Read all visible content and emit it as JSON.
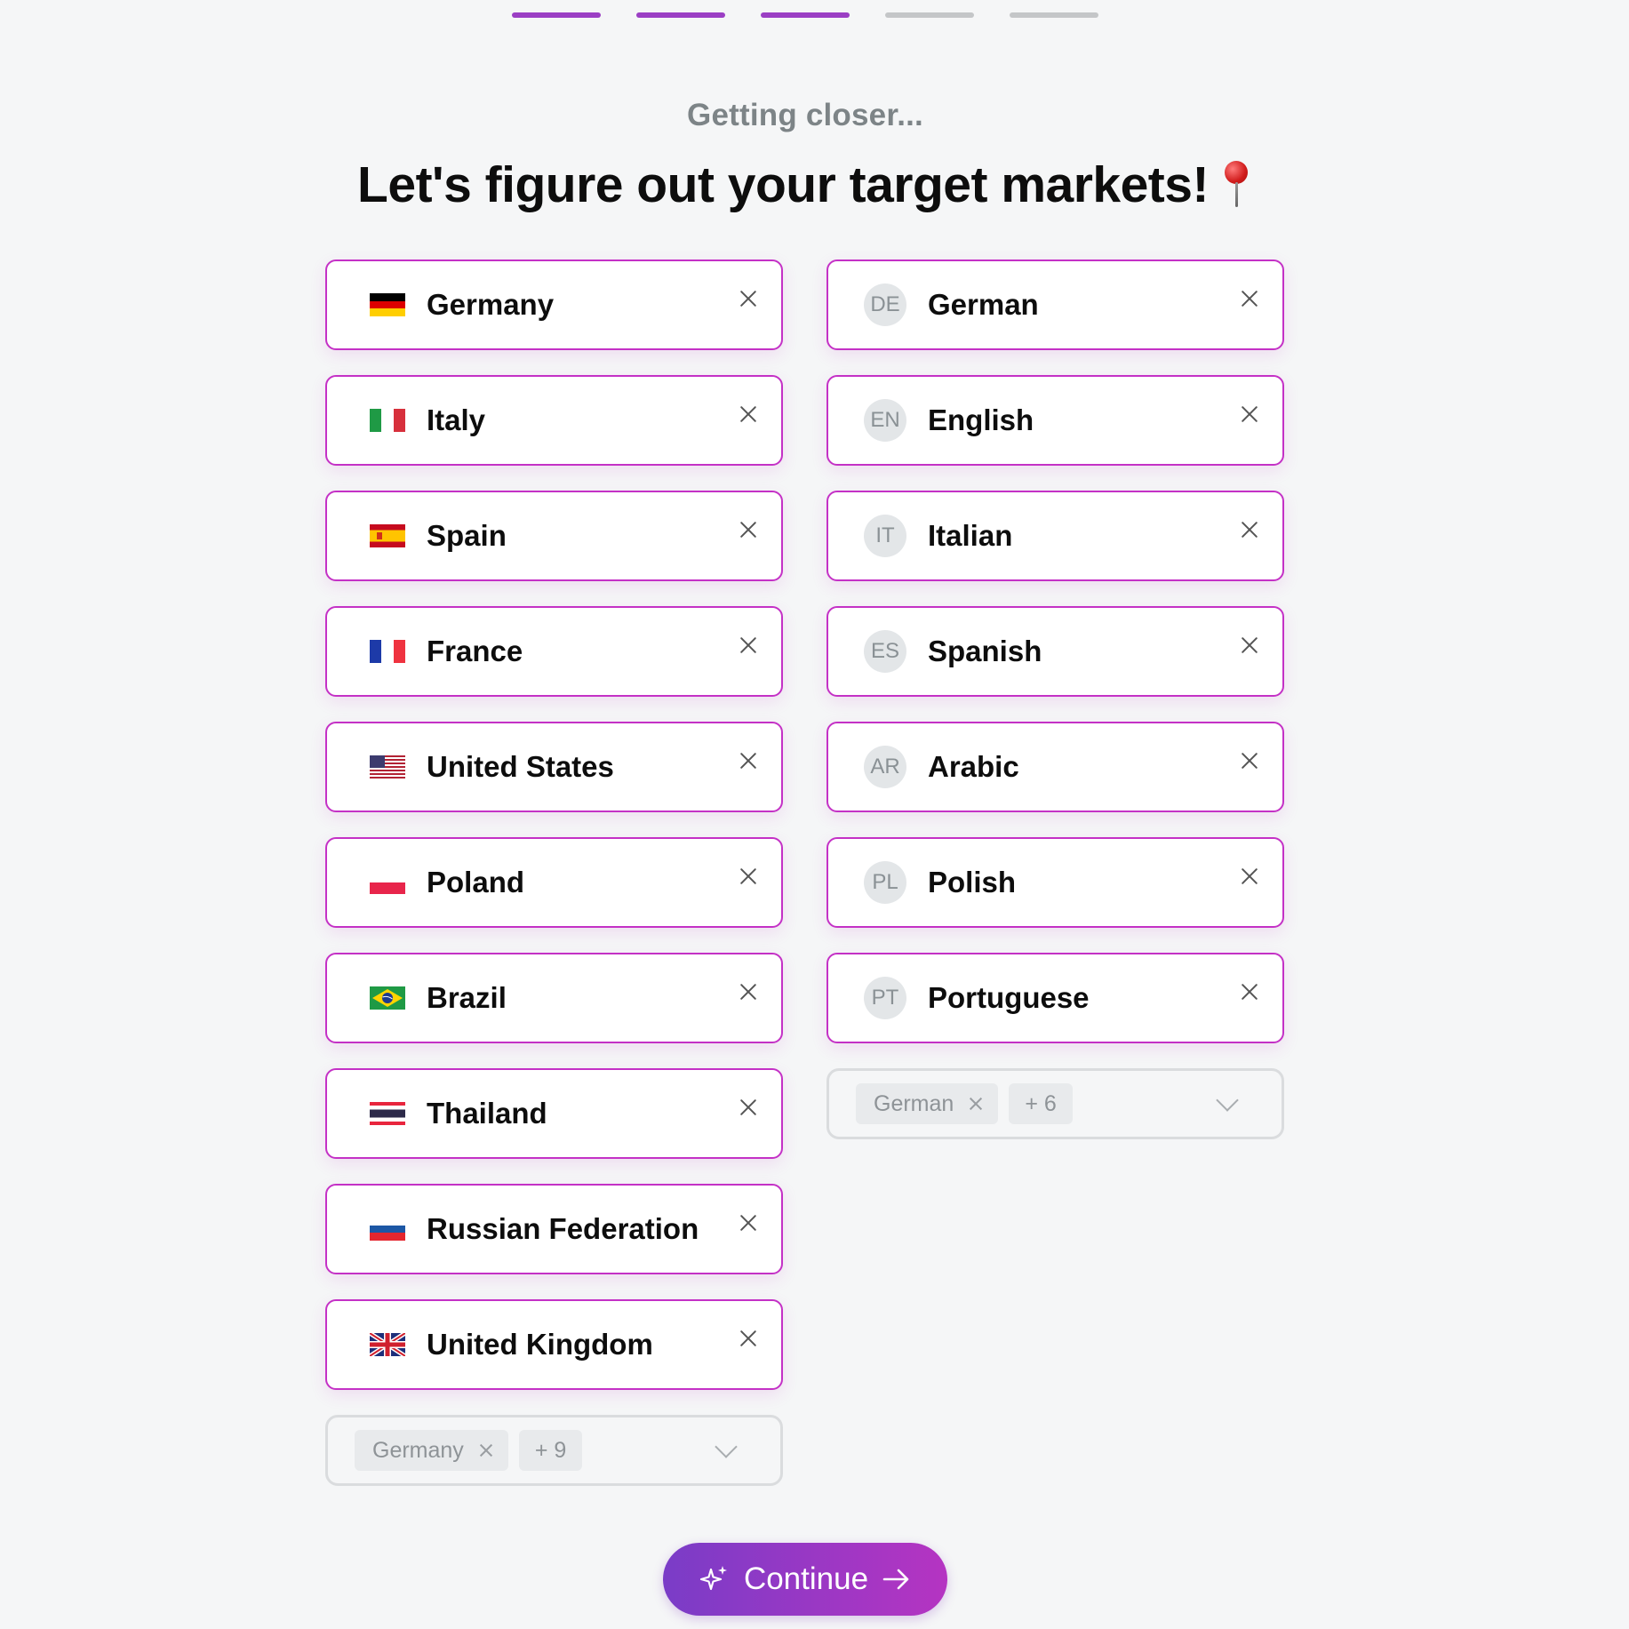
{
  "progress": {
    "steps_total": 5,
    "steps_done": 3
  },
  "header": {
    "subtitle": "Getting closer...",
    "title": "Let's figure out your target markets!",
    "title_emoji": "round-pushpin"
  },
  "countries": {
    "items": [
      {
        "label": "Germany",
        "flag": "de"
      },
      {
        "label": "Italy",
        "flag": "it"
      },
      {
        "label": "Spain",
        "flag": "es"
      },
      {
        "label": "France",
        "flag": "fr"
      },
      {
        "label": "United States",
        "flag": "us"
      },
      {
        "label": "Poland",
        "flag": "pl"
      },
      {
        "label": "Brazil",
        "flag": "br"
      },
      {
        "label": "Thailand",
        "flag": "th"
      },
      {
        "label": "Russian Federation",
        "flag": "ru"
      },
      {
        "label": "United Kingdom",
        "flag": "gb"
      }
    ],
    "select": {
      "tag": "Germany",
      "more": "+ 9"
    }
  },
  "languages": {
    "items": [
      {
        "code": "DE",
        "label": "German"
      },
      {
        "code": "EN",
        "label": "English"
      },
      {
        "code": "IT",
        "label": "Italian"
      },
      {
        "code": "ES",
        "label": "Spanish"
      },
      {
        "code": "AR",
        "label": "Arabic"
      },
      {
        "code": "PL",
        "label": "Polish"
      },
      {
        "code": "PT",
        "label": "Portuguese"
      }
    ],
    "select": {
      "tag": "German",
      "more": "+ 6"
    }
  },
  "continue_button": {
    "label": "Continue"
  },
  "colors": {
    "accent": "#c431c6",
    "progress_done": "#9b3fc4",
    "button_start": "#7a3cc7",
    "button_end": "#b534c2"
  }
}
